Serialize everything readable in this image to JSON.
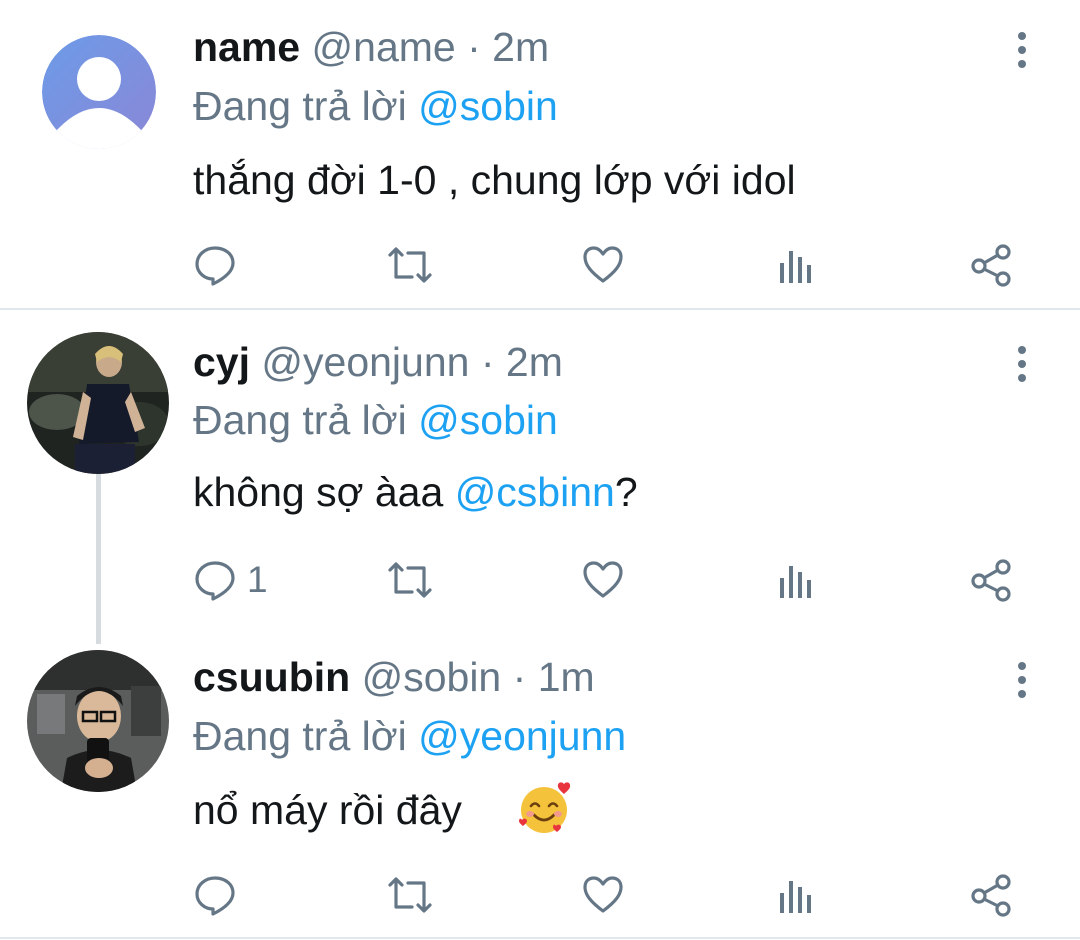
{
  "tweets": [
    {
      "display_name": "name",
      "handle": "@name",
      "separator": "·",
      "time": "2m",
      "reply_prefix": "Đang trả lời",
      "reply_to": "@sobin",
      "text": "thắng đời 1-0 , chung lớp với idol",
      "reply_count": "",
      "avatar": "default-avatar-placeholder"
    },
    {
      "display_name": "cyj",
      "handle": "@yeonjunn",
      "separator": "·",
      "time": "2m",
      "reply_prefix": "Đang trả lời",
      "reply_to": "@sobin",
      "text_before": "không sợ àaa ",
      "text_mention": "@csbinn",
      "text_after": "?",
      "reply_count": "1",
      "avatar": "user-photo"
    },
    {
      "display_name": "csuubin",
      "handle": "@sobin",
      "separator": "·",
      "time": "1m",
      "reply_prefix": "Đang trả lời",
      "reply_to": "@yeonjunn",
      "text": "nổ máy rồi đây",
      "emoji": "smiling-face-with-hearts",
      "reply_count": "",
      "avatar": "user-photo"
    }
  ],
  "icons": [
    "reply-icon",
    "retweet-icon",
    "like-icon",
    "analytics-icon",
    "share-icon",
    "more-options-icon"
  ],
  "colors": {
    "text": "#14171a",
    "secondary": "#657786",
    "link": "#1da1f2",
    "divider": "#e1e8ed",
    "default_avatar": "#7a93e0"
  }
}
